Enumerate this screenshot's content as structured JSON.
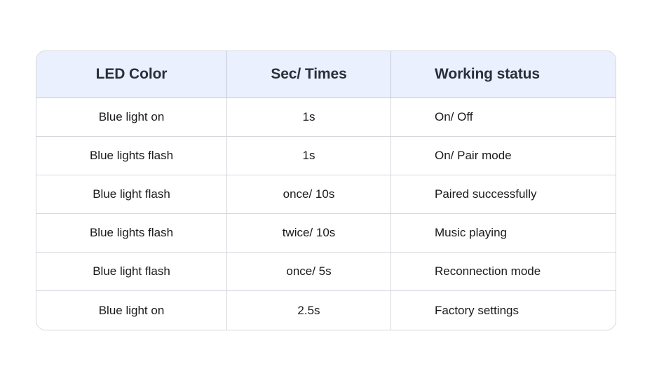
{
  "table": {
    "columns": [
      "LED Color",
      "Sec/ Times",
      "Working status"
    ],
    "rows": [
      {
        "led_color": "Blue light on",
        "sec_times": "1s",
        "working_status": "On/ Off"
      },
      {
        "led_color": "Blue lights flash",
        "sec_times": "1s",
        "working_status": "On/ Pair mode"
      },
      {
        "led_color": "Blue light flash",
        "sec_times": "once/ 10s",
        "working_status": "Paired successfully"
      },
      {
        "led_color": "Blue lights flash",
        "sec_times": "twice/ 10s",
        "working_status": "Music playing"
      },
      {
        "led_color": "Blue light flash",
        "sec_times": "once/ 5s",
        "working_status": "Reconnection mode"
      },
      {
        "led_color": "Blue light on",
        "sec_times": "2.5s",
        "working_status": "Factory settings"
      }
    ]
  },
  "colors": {
    "header_background": "#eaf0fd",
    "header_text": "#2b2f3a",
    "body_text": "#1a1a1a",
    "border": "#d5d7dd",
    "header_border": "#c9ccd6",
    "page_background": "#ffffff"
  }
}
